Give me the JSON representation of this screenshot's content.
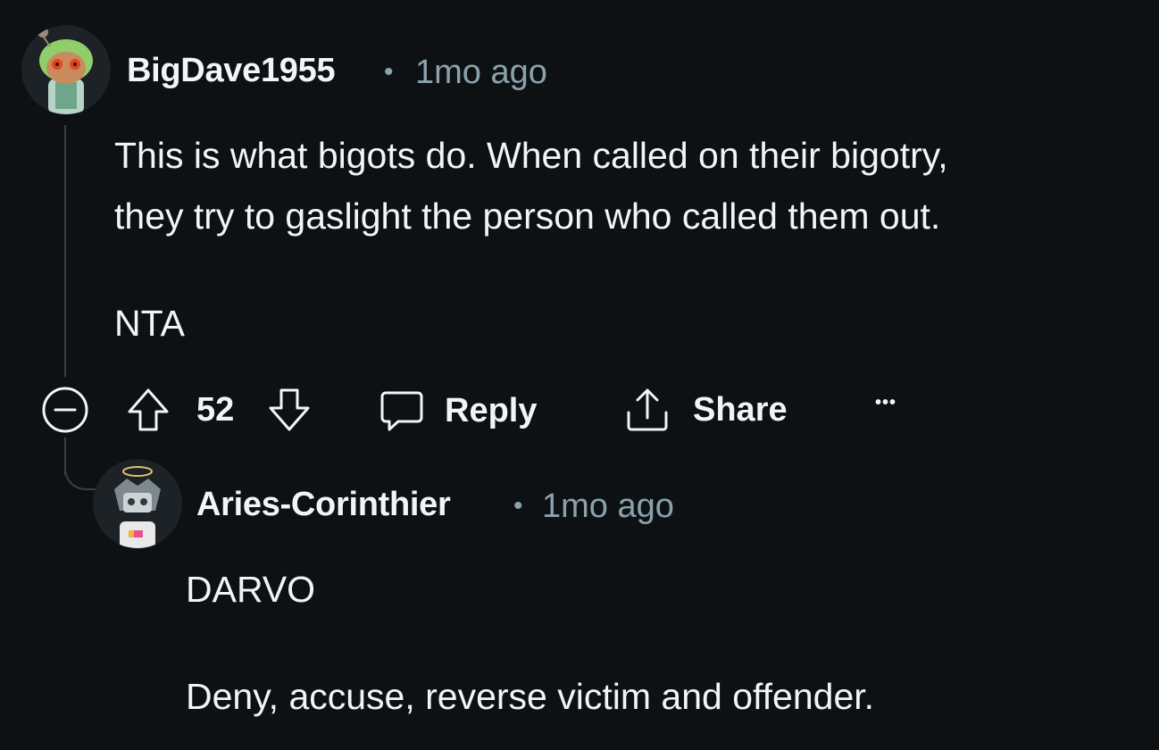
{
  "comment": {
    "author": "BigDave1955",
    "separator": "•",
    "time": "1mo ago",
    "body_line1": "This is what bigots do. When called on their bigotry,",
    "body_line2": "they try to gaslight the person who called them out.",
    "body_line3": "NTA",
    "vote_count": "52",
    "reply_label": "Reply",
    "share_label": "Share",
    "more_label": "•••"
  },
  "reply": {
    "author": "Aries-Corinthier",
    "separator": "•",
    "time": "1mo ago",
    "body_line1": "DARVO",
    "body_line2": "Deny, accuse, reverse victim and offender."
  },
  "icons": {
    "collapse": "collapse-icon",
    "upvote": "upvote-icon",
    "downvote": "downvote-icon",
    "reply": "comment-icon",
    "share": "share-icon"
  },
  "colors": {
    "background": "#0e1113",
    "text": "#f2f4f5",
    "meta": "#8ba2ad",
    "thread": "#3a3f42"
  }
}
